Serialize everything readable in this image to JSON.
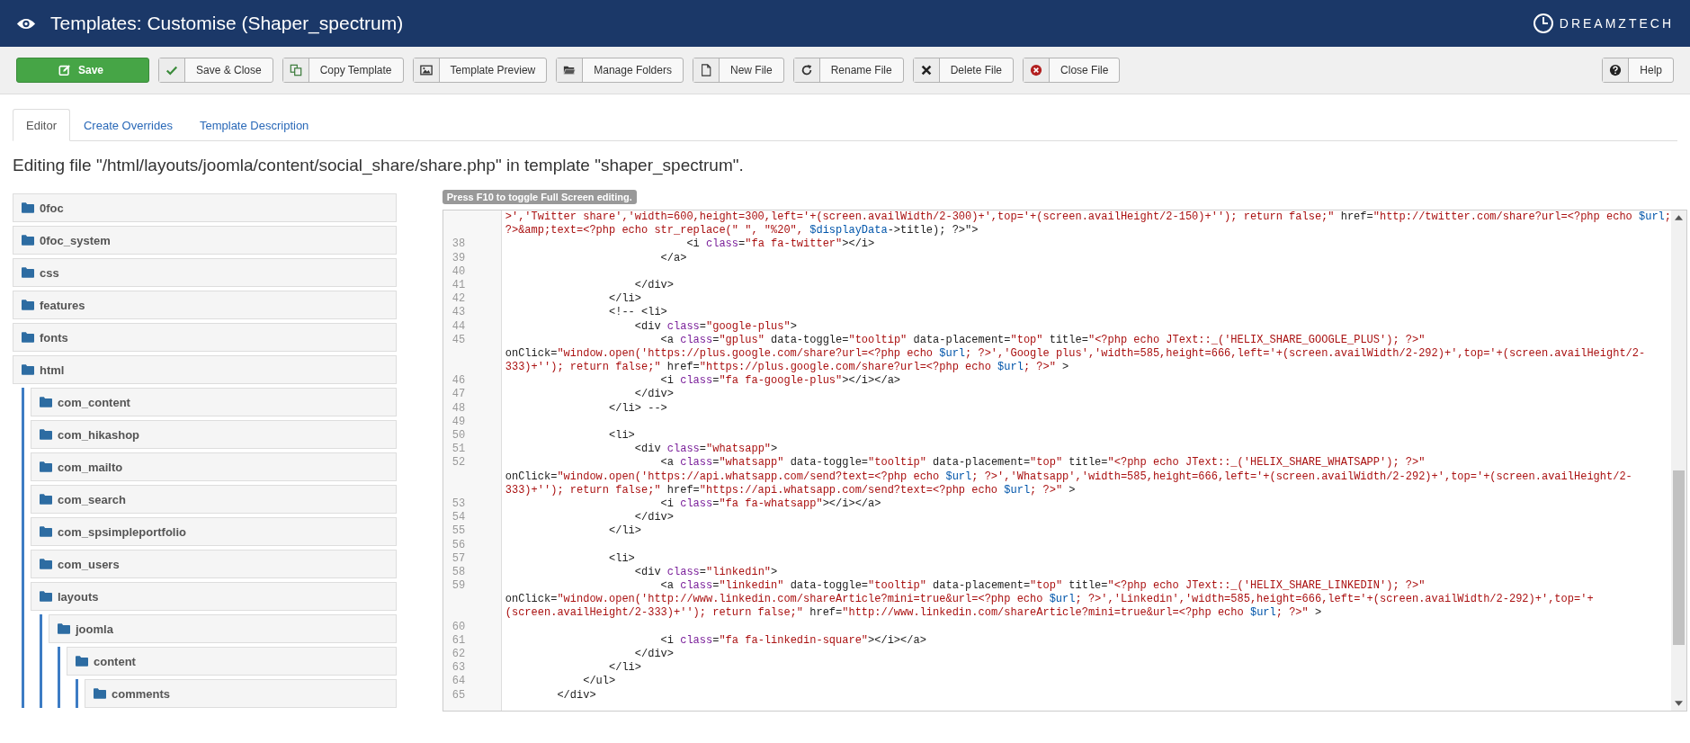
{
  "header": {
    "title": "Templates: Customise (Shaper_spectrum)",
    "brand": "DREAMZTECH"
  },
  "toolbar": [
    {
      "label": "Save",
      "kind": "primary"
    },
    {
      "label": "Save & Close",
      "kind": "default"
    },
    {
      "label": "Copy Template",
      "kind": "default"
    },
    {
      "label": "Template Preview",
      "kind": "default"
    },
    {
      "label": "Manage Folders",
      "kind": "default"
    },
    {
      "label": "New File",
      "kind": "default"
    },
    {
      "label": "Rename File",
      "kind": "default"
    },
    {
      "label": "Delete File",
      "kind": "default"
    },
    {
      "label": "Close File",
      "kind": "default"
    }
  ],
  "help_button": {
    "label": "Help"
  },
  "tabs": [
    {
      "label": "Editor",
      "selected": true
    },
    {
      "label": "Create Overrides",
      "selected": false
    },
    {
      "label": "Template Description",
      "selected": false
    }
  ],
  "heading": "Editing file \"/html/layouts/joomla/content/social_share/share.php\" in template \"shaper_spectrum\".",
  "tree": [
    {
      "name": "0foc"
    },
    {
      "name": "0foc_system"
    },
    {
      "name": "css"
    },
    {
      "name": "features"
    },
    {
      "name": "fonts"
    },
    {
      "name": "html",
      "children": [
        {
          "name": "com_content"
        },
        {
          "name": "com_hikashop"
        },
        {
          "name": "com_mailto"
        },
        {
          "name": "com_search"
        },
        {
          "name": "com_spsimpleportfolio"
        },
        {
          "name": "com_users"
        },
        {
          "name": "layouts",
          "children": [
            {
              "name": "joomla",
              "children": [
                {
                  "name": "content",
                  "children": [
                    {
                      "name": "comments"
                    }
                  ]
                }
              ]
            }
          ]
        }
      ]
    }
  ],
  "editor_hint": "Press F10 to toggle Full Screen editing.",
  "code_rows": [
    {
      "parts": [
        {
          "kind": "string",
          "text": ">','Twitter share','width=600,height=300,left='+(screen.availWidth/2-300)+',top='+(screen.availHeight/2-150)+''); return false;\""
        },
        {
          "kind": "plain",
          "text": " href="
        },
        {
          "kind": "string",
          "text": "\"http://twitter.com/share?url=<?php echo "
        },
        {
          "kind": "var",
          "text": "$url"
        },
        {
          "kind": "string",
          "text": ";"
        }
      ]
    },
    {
      "parts": [
        {
          "kind": "string",
          "text": "?>&amp;text=<?php echo str_replace(\" \", \"%20\", "
        },
        {
          "kind": "var",
          "text": "$displayData"
        },
        {
          "kind": "plain",
          "text": "->title); ?>\">"
        }
      ]
    },
    {
      "number": "38",
      "parts": [
        {
          "kind": "plain",
          "text": "                            <i "
        },
        {
          "kind": "attr",
          "text": "class"
        },
        {
          "kind": "plain",
          "text": "="
        },
        {
          "kind": "string",
          "text": "\"fa fa-twitter\""
        },
        {
          "kind": "plain",
          "text": "></i>"
        }
      ]
    },
    {
      "number": "39",
      "parts": [
        {
          "kind": "plain",
          "text": "                        </a>"
        }
      ]
    },
    {
      "number": "40"
    },
    {
      "number": "41",
      "parts": [
        {
          "kind": "plain",
          "text": "                    </div>"
        }
      ]
    },
    {
      "number": "42",
      "parts": [
        {
          "kind": "plain",
          "text": "                </li>"
        }
      ]
    },
    {
      "number": "43",
      "parts": [
        {
          "kind": "plain",
          "text": "                <!-- <li>"
        }
      ]
    },
    {
      "number": "44",
      "parts": [
        {
          "kind": "plain",
          "text": "                    <div "
        },
        {
          "kind": "attr",
          "text": "class"
        },
        {
          "kind": "plain",
          "text": "="
        },
        {
          "kind": "string",
          "text": "\"google-plus\""
        },
        {
          "kind": "plain",
          "text": ">"
        }
      ]
    },
    {
      "number": "45",
      "parts": [
        {
          "kind": "plain",
          "text": "                        <a "
        },
        {
          "kind": "attr",
          "text": "class"
        },
        {
          "kind": "plain",
          "text": "="
        },
        {
          "kind": "string",
          "text": "\"gplus\""
        },
        {
          "kind": "plain",
          "text": " data-toggle="
        },
        {
          "kind": "string",
          "text": "\"tooltip\""
        },
        {
          "kind": "plain",
          "text": " data-placement="
        },
        {
          "kind": "string",
          "text": "\"top\""
        },
        {
          "kind": "plain",
          "text": " title="
        },
        {
          "kind": "string",
          "text": "\"<?php echo JText::_('HELIX_SHARE_GOOGLE_PLUS'); ?>\""
        }
      ]
    },
    {
      "parts": [
        {
          "kind": "plain",
          "text": "onClick="
        },
        {
          "kind": "string",
          "text": "\"window.open('https://plus.google.com/share?url=<?php echo "
        },
        {
          "kind": "var",
          "text": "$url"
        },
        {
          "kind": "string",
          "text": "; ?>','Google plus','width=585,height=666,left='+(screen.availWidth/2-292)+',top='+(screen.availHeight/2-"
        }
      ]
    },
    {
      "parts": [
        {
          "kind": "string",
          "text": "333)+''); return false;\""
        },
        {
          "kind": "plain",
          "text": " href="
        },
        {
          "kind": "string",
          "text": "\"https://plus.google.com/share?url=<?php echo "
        },
        {
          "kind": "var",
          "text": "$url"
        },
        {
          "kind": "string",
          "text": "; ?>\""
        },
        {
          "kind": "plain",
          "text": " >"
        }
      ]
    },
    {
      "number": "46",
      "parts": [
        {
          "kind": "plain",
          "text": "                        <i "
        },
        {
          "kind": "attr",
          "text": "class"
        },
        {
          "kind": "plain",
          "text": "="
        },
        {
          "kind": "string",
          "text": "\"fa fa-google-plus\""
        },
        {
          "kind": "plain",
          "text": "></i></a>"
        }
      ]
    },
    {
      "number": "47",
      "parts": [
        {
          "kind": "plain",
          "text": "                    </div>"
        }
      ]
    },
    {
      "number": "48",
      "parts": [
        {
          "kind": "plain",
          "text": "                </li> -->"
        }
      ]
    },
    {
      "number": "49"
    },
    {
      "number": "50",
      "parts": [
        {
          "kind": "plain",
          "text": "                <li>"
        }
      ]
    },
    {
      "number": "51",
      "parts": [
        {
          "kind": "plain",
          "text": "                    <div "
        },
        {
          "kind": "attr",
          "text": "class"
        },
        {
          "kind": "plain",
          "text": "="
        },
        {
          "kind": "string",
          "text": "\"whatsapp\""
        },
        {
          "kind": "plain",
          "text": ">"
        }
      ]
    },
    {
      "number": "52",
      "parts": [
        {
          "kind": "plain",
          "text": "                        <a "
        },
        {
          "kind": "attr",
          "text": "class"
        },
        {
          "kind": "plain",
          "text": "="
        },
        {
          "kind": "string",
          "text": "\"whatsapp\""
        },
        {
          "kind": "plain",
          "text": " data-toggle="
        },
        {
          "kind": "string",
          "text": "\"tooltip\""
        },
        {
          "kind": "plain",
          "text": " data-placement="
        },
        {
          "kind": "string",
          "text": "\"top\""
        },
        {
          "kind": "plain",
          "text": " title="
        },
        {
          "kind": "string",
          "text": "\"<?php echo JText::_('HELIX_SHARE_WHATSAPP'); ?>\""
        }
      ]
    },
    {
      "parts": [
        {
          "kind": "plain",
          "text": "onClick="
        },
        {
          "kind": "string",
          "text": "\"window.open('https://api.whatsapp.com/send?text=<?php echo "
        },
        {
          "kind": "var",
          "text": "$url"
        },
        {
          "kind": "string",
          "text": "; ?>','Whatsapp','width=585,height=666,left='+(screen.availWidth/2-292)+',top='+(screen.availHeight/2-"
        }
      ]
    },
    {
      "parts": [
        {
          "kind": "string",
          "text": "333)+''); return false;\""
        },
        {
          "kind": "plain",
          "text": " href="
        },
        {
          "kind": "string",
          "text": "\"https://api.whatsapp.com/send?text=<?php echo "
        },
        {
          "kind": "var",
          "text": "$url"
        },
        {
          "kind": "string",
          "text": "; ?>\""
        },
        {
          "kind": "plain",
          "text": " >"
        }
      ]
    },
    {
      "number": "53",
      "parts": [
        {
          "kind": "plain",
          "text": "                        <i "
        },
        {
          "kind": "attr",
          "text": "class"
        },
        {
          "kind": "plain",
          "text": "="
        },
        {
          "kind": "string",
          "text": "\"fa fa-whatsapp\""
        },
        {
          "kind": "plain",
          "text": "></i></a>"
        }
      ]
    },
    {
      "number": "54",
      "parts": [
        {
          "kind": "plain",
          "text": "                    </div>"
        }
      ]
    },
    {
      "number": "55",
      "parts": [
        {
          "kind": "plain",
          "text": "                </li>"
        }
      ]
    },
    {
      "number": "56"
    },
    {
      "number": "57",
      "parts": [
        {
          "kind": "plain",
          "text": "                <li>"
        }
      ]
    },
    {
      "number": "58",
      "parts": [
        {
          "kind": "plain",
          "text": "                    <div "
        },
        {
          "kind": "attr",
          "text": "class"
        },
        {
          "kind": "plain",
          "text": "="
        },
        {
          "kind": "string",
          "text": "\"linkedin\""
        },
        {
          "kind": "plain",
          "text": ">"
        }
      ]
    },
    {
      "number": "59",
      "parts": [
        {
          "kind": "plain",
          "text": "                        <a "
        },
        {
          "kind": "attr",
          "text": "class"
        },
        {
          "kind": "plain",
          "text": "="
        },
        {
          "kind": "string",
          "text": "\"linkedin\""
        },
        {
          "kind": "plain",
          "text": " data-toggle="
        },
        {
          "kind": "string",
          "text": "\"tooltip\""
        },
        {
          "kind": "plain",
          "text": " data-placement="
        },
        {
          "kind": "string",
          "text": "\"top\""
        },
        {
          "kind": "plain",
          "text": " title="
        },
        {
          "kind": "string",
          "text": "\"<?php echo JText::_('HELIX_SHARE_LINKEDIN'); ?>\""
        }
      ]
    },
    {
      "parts": [
        {
          "kind": "plain",
          "text": "onClick="
        },
        {
          "kind": "string",
          "text": "\"window.open('http://www.linkedin.com/shareArticle?mini=true&url=<?php echo "
        },
        {
          "kind": "var",
          "text": "$url"
        },
        {
          "kind": "string",
          "text": "; ?>','Linkedin','width=585,height=666,left='+(screen.availWidth/2-292)+',top='+"
        }
      ]
    },
    {
      "parts": [
        {
          "kind": "string",
          "text": "(screen.availHeight/2-333)+''); return false;\""
        },
        {
          "kind": "plain",
          "text": " href="
        },
        {
          "kind": "string",
          "text": "\"http://www.linkedin.com/shareArticle?mini=true&url=<?php echo "
        },
        {
          "kind": "var",
          "text": "$url"
        },
        {
          "kind": "string",
          "text": "; ?>\""
        },
        {
          "kind": "plain",
          "text": " >"
        }
      ]
    },
    {
      "number": "60"
    },
    {
      "number": "61",
      "parts": [
        {
          "kind": "plain",
          "text": "                        <i "
        },
        {
          "kind": "attr",
          "text": "class"
        },
        {
          "kind": "plain",
          "text": "="
        },
        {
          "kind": "string",
          "text": "\"fa fa-linkedin-square\""
        },
        {
          "kind": "plain",
          "text": "></i></a>"
        }
      ]
    },
    {
      "number": "62",
      "parts": [
        {
          "kind": "plain",
          "text": "                    </div>"
        }
      ]
    },
    {
      "number": "63",
      "parts": [
        {
          "kind": "plain",
          "text": "                </li>"
        }
      ]
    },
    {
      "number": "64",
      "parts": [
        {
          "kind": "plain",
          "text": "            </ul>"
        }
      ]
    },
    {
      "number": "65",
      "parts": [
        {
          "kind": "plain",
          "text": "        </div>"
        }
      ]
    }
  ]
}
